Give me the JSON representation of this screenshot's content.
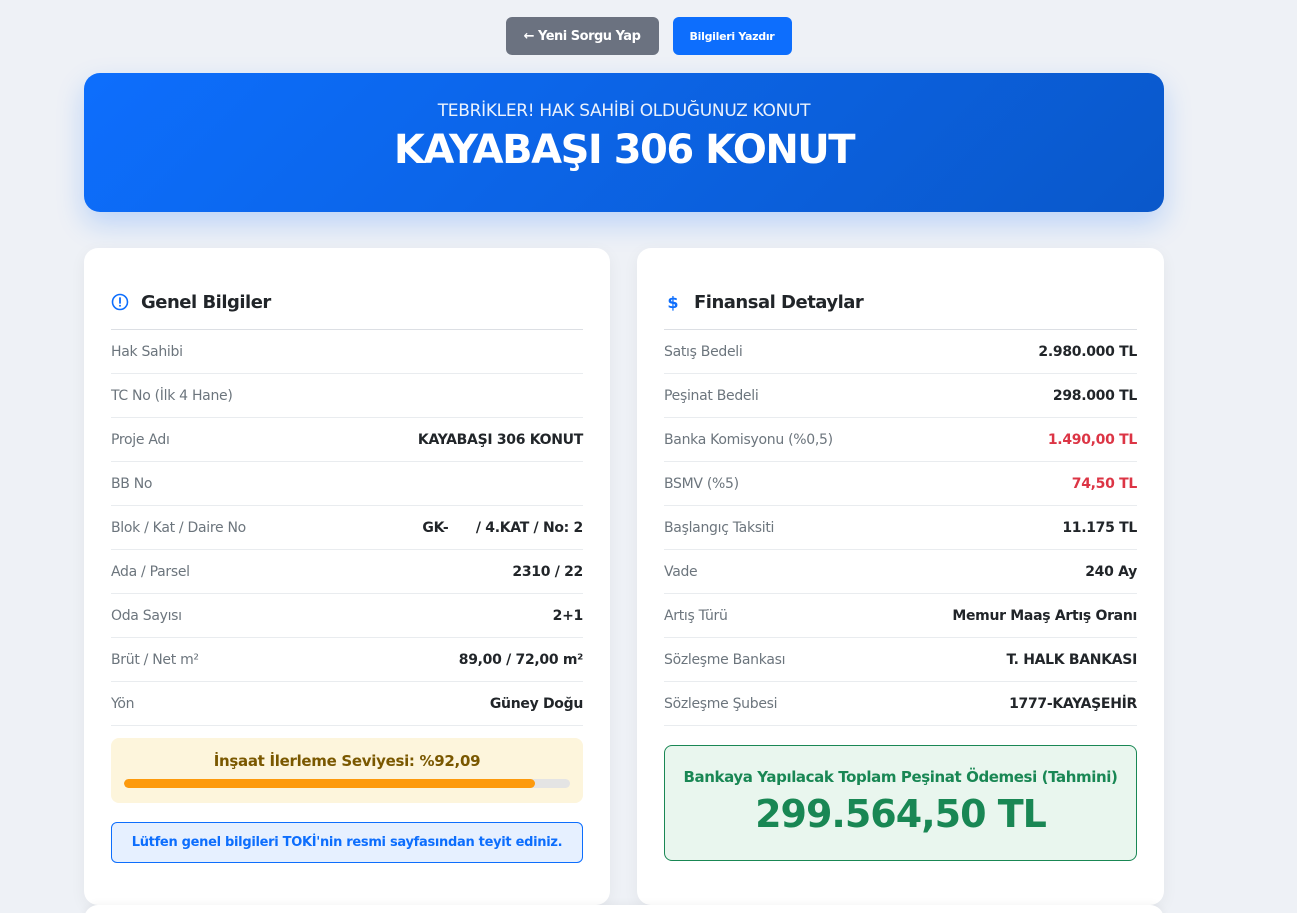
{
  "toolbar": {
    "back_label": "← Yeni Sorgu Yap",
    "print_label": "Bilgileri Yazdır"
  },
  "hero": {
    "subtitle": "TEBRİKLER! HAK SAHİBİ OLDUĞUNUZ KONUT",
    "title": "KAYABAŞI 306 KONUT"
  },
  "colors": {
    "primary": "#0d6efd",
    "danger": "#dc3545",
    "success": "#198754",
    "progress": "#fd9a0c"
  },
  "general": {
    "icon": "info-circle-icon",
    "title": "Genel Bilgiler",
    "rows": [
      {
        "label": "Hak Sahibi",
        "value": ""
      },
      {
        "label": "TC No (İlk 4 Hane)",
        "value": ""
      },
      {
        "label": "Proje Adı",
        "value": "KAYABAŞI 306 KONUT"
      },
      {
        "label": "BB No",
        "value": ""
      },
      {
        "label": "Blok / Kat / Daire No",
        "value": "GK-      / 4.KAT / No: 2"
      },
      {
        "label": "Ada / Parsel",
        "value": "2310 / 22"
      },
      {
        "label": "Oda Sayısı",
        "value": "2+1"
      },
      {
        "label": "Brüt / Net m²",
        "value": "89,00 / 72,00 m²"
      },
      {
        "label": "Yön",
        "value": "Güney Doğu"
      }
    ],
    "progress": {
      "label": "İnşaat İlerleme Seviyesi: %92,09",
      "percent": 92.09
    },
    "notice": "Lütfen genel bilgileri TOKİ'nin resmi sayfasından teyit ediniz."
  },
  "finance": {
    "icon": "dollar-icon",
    "title": "Finansal Detaylar",
    "rows": [
      {
        "label": "Satış Bedeli",
        "value": "2.980.000 TL",
        "highlight": false
      },
      {
        "label": "Peşinat Bedeli",
        "value": "298.000 TL",
        "highlight": false
      },
      {
        "label": "Banka Komisyonu (%0,5)",
        "value": "1.490,00 TL",
        "highlight": true
      },
      {
        "label": "BSMV (%5)",
        "value": "74,50 TL",
        "highlight": true
      },
      {
        "label": "Başlangıç Taksiti",
        "value": "11.175 TL",
        "highlight": false
      },
      {
        "label": "Vade",
        "value": "240 Ay",
        "highlight": false
      },
      {
        "label": "Artış Türü",
        "value": "Memur Maaş Artış Oranı",
        "highlight": false
      },
      {
        "label": "Sözleşme Bankası",
        "value": "T. HALK BANKASI",
        "highlight": false
      },
      {
        "label": "Sözleşme Şubesi",
        "value": "1777-KAYAŞEHİR",
        "highlight": false
      }
    ],
    "total": {
      "label": "Bankaya Yapılacak Toplam Peşinat Ödemesi (Tahmini)",
      "amount": "299.564,50 TL"
    }
  }
}
